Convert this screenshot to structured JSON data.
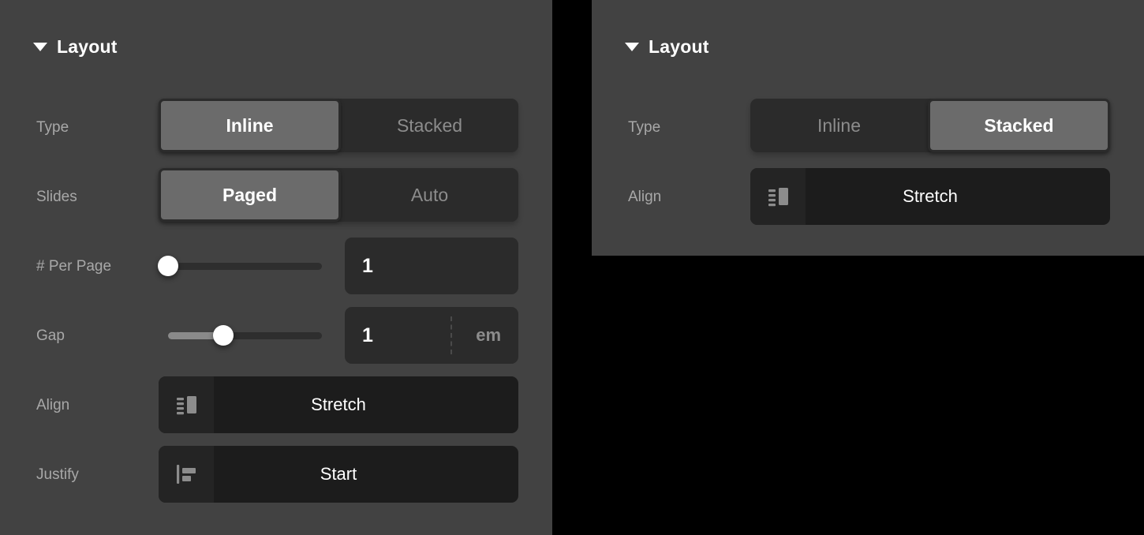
{
  "panels": [
    {
      "id": "left",
      "header": {
        "title": "Layout",
        "disclosure": "triangle-down-icon",
        "expanded": true
      },
      "rows": [
        {
          "label": "Type",
          "control": "segmented",
          "options": [
            "Inline",
            "Stacked"
          ],
          "selected": "Inline",
          "selected_index": 0
        },
        {
          "label": "Slides",
          "control": "segmented",
          "options": [
            "Paged",
            "Auto"
          ],
          "selected": "Paged",
          "selected_index": 0
        },
        {
          "label": "# Per Page",
          "control": "slider-number",
          "value": "1",
          "unit": "",
          "slider_percent": 2
        },
        {
          "label": "Gap",
          "control": "slider-number",
          "value": "1",
          "unit": "em",
          "slider_percent": 36
        },
        {
          "label": "Align",
          "control": "picker",
          "icon": "align-stretch-icon",
          "value": "Stretch"
        },
        {
          "label": "Justify",
          "control": "picker",
          "icon": "justify-start-icon",
          "value": "Start"
        }
      ]
    },
    {
      "id": "right",
      "header": {
        "title": "Layout",
        "disclosure": "triangle-down-icon",
        "expanded": true
      },
      "rows": [
        {
          "label": "Type",
          "control": "segmented",
          "options": [
            "Inline",
            "Stacked"
          ],
          "selected": "Stacked",
          "selected_index": 1
        },
        {
          "label": "Align",
          "control": "picker",
          "icon": "align-stretch-icon",
          "value": "Stretch"
        }
      ]
    }
  ],
  "colors": {
    "background": "#000000",
    "panel": "#424242",
    "control_track": "#2b2b2b",
    "segment_active": "#6b6b6b",
    "picker_bg": "#1c1c1c",
    "picker_icon_bg": "#242424",
    "label_text": "#a8a8a8",
    "inactive_text": "#8c8c8c",
    "active_text": "#ffffff",
    "slider_fill": "#8a8a8a",
    "slider_thumb": "#ffffff"
  }
}
